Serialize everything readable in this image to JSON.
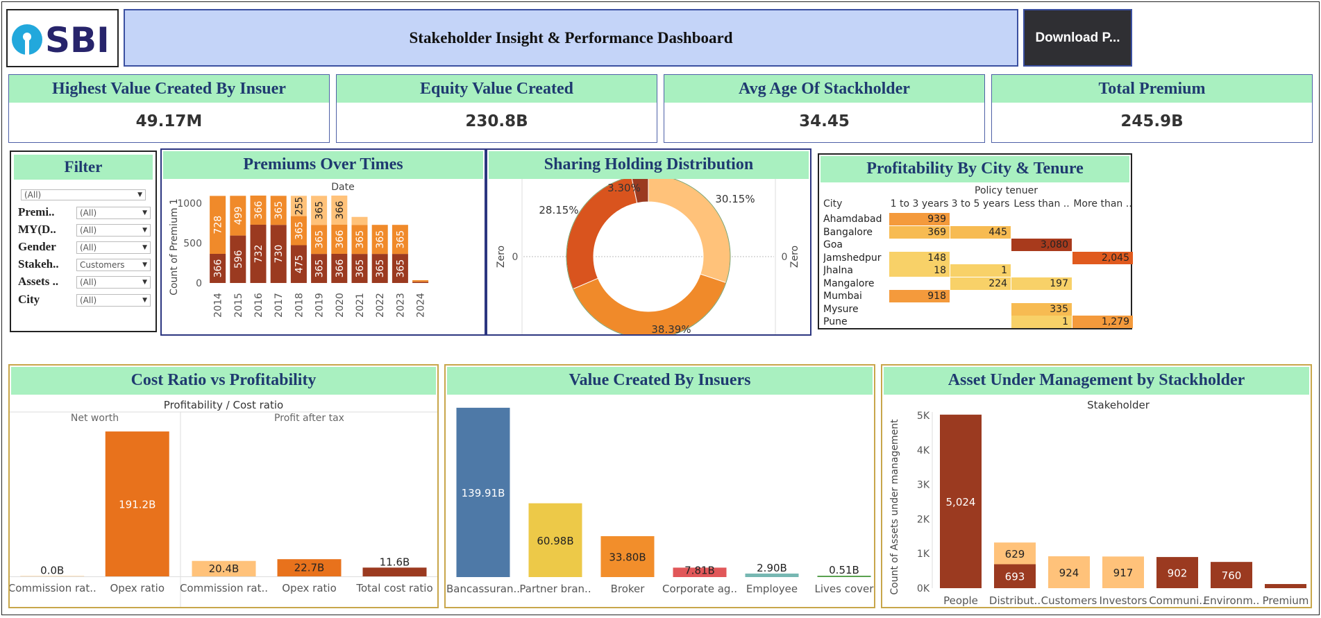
{
  "header": {
    "logo_text": "SBI",
    "title": "Stakeholder Insight & Performance Dashboard",
    "download_label": "Download P..."
  },
  "kpis": [
    {
      "title": "Highest Value Created By Insuer",
      "value": "49.17M"
    },
    {
      "title": "Equity Value Created",
      "value": "230.8B"
    },
    {
      "title": "Avg Age Of Stackholder",
      "value": "34.45"
    },
    {
      "title": "Total Premium",
      "value": "245.9B"
    }
  ],
  "filter": {
    "title": "Filter",
    "top_value": "(All)",
    "rows": [
      {
        "label": "Premi..",
        "value": "(All)"
      },
      {
        "label": "MY(D..",
        "value": "(All)"
      },
      {
        "label": "Gender",
        "value": "(All)"
      },
      {
        "label": "Stakeh..",
        "value": "Customers"
      },
      {
        "label": "Assets ..",
        "value": "(All)"
      },
      {
        "label": "City",
        "value": "(All)"
      }
    ]
  },
  "colors": {
    "dark": "#9b3a20",
    "orange": "#f08a2a",
    "mid_orange": "#e8721c",
    "light": "#ffc27a",
    "pale": "#f6cd6a",
    "blue": "#4e79a7",
    "yellow": "#edc948",
    "red": "#e15759",
    "teal": "#76b7b2",
    "green_header": "#a9f0c0"
  },
  "premiums": {
    "title": "Premiums Over  Times",
    "chart_data": {
      "type": "bar",
      "title": "Premiums Over  Times",
      "xlabel": "Date",
      "ylabel": "Count of Premium 1",
      "ylim": [
        0,
        1150
      ],
      "yticks": [
        "0",
        "500",
        "1000"
      ],
      "categories": [
        "2014",
        "2015",
        "2016",
        "2017",
        "2018",
        "2019",
        "2020",
        "2021",
        "2022",
        "2023",
        "2024"
      ],
      "series": [
        {
          "values": [
            366,
            596,
            732,
            730,
            475,
            365,
            366,
            365,
            365,
            365,
            15
          ],
          "labels": [
            "366",
            "596",
            "732",
            "730",
            "475",
            "365",
            "366",
            "365",
            "365",
            "365",
            ""
          ],
          "color": "#9b3a20"
        },
        {
          "values": [
            728,
            499,
            366,
            365,
            365,
            365,
            366,
            365,
            365,
            365,
            20
          ],
          "labels": [
            "728",
            "499",
            "366",
            "365",
            "365",
            "365",
            "366",
            "365",
            "365",
            "365",
            ""
          ],
          "color": "#f08a2a"
        },
        {
          "values": [
            0,
            0,
            0,
            0,
            255,
            365,
            366,
            100,
            0,
            0,
            0
          ],
          "labels": [
            "",
            "",
            "",
            "",
            "255",
            "365",
            "366",
            "",
            "",
            "",
            ""
          ],
          "color": "#ffc27a"
        }
      ]
    }
  },
  "sharing": {
    "title": "Sharing Holding Distribution",
    "axis_label": "Zero",
    "zero_tick": "0",
    "chart_data": {
      "type": "pie",
      "title": "Sharing Holding Distribution",
      "values": [
        30.15,
        38.39,
        28.15,
        3.3
      ],
      "labels": [
        "30.15%",
        "38.39%",
        "28.15%",
        "3.30%"
      ],
      "colors": [
        "#ffc27a",
        "#f08a2a",
        "#d9541e",
        "#9b3a20"
      ]
    }
  },
  "profitability": {
    "title": "Profitability By City & Tenure",
    "column_group": "Policy tenuer",
    "row_header": "City",
    "columns": [
      "1 to 3 years",
      "3 to 5 years",
      "Less than ..",
      "More than .."
    ],
    "rows": [
      {
        "city": "Ahamdabad",
        "cells": [
          "939",
          "",
          "",
          ""
        ]
      },
      {
        "city": "Bangalore",
        "cells": [
          "369",
          "445",
          "",
          ""
        ]
      },
      {
        "city": "Goa",
        "cells": [
          "",
          "",
          "3,080",
          ""
        ]
      },
      {
        "city": "Jamshedpur",
        "cells": [
          "148",
          "",
          "",
          "2,045"
        ]
      },
      {
        "city": "Jhalna",
        "cells": [
          "18",
          "1",
          "",
          ""
        ]
      },
      {
        "city": "Mangalore",
        "cells": [
          "",
          "224",
          "197",
          ""
        ]
      },
      {
        "city": "Mumbai",
        "cells": [
          "918",
          "",
          "",
          ""
        ]
      },
      {
        "city": "Mysure",
        "cells": [
          "",
          "",
          "335",
          ""
        ]
      },
      {
        "city": "Pune",
        "cells": [
          "",
          "",
          "1",
          "1,279"
        ]
      }
    ],
    "chart_data": {
      "type": "heatmap",
      "title": "Profitability By City & Tenure",
      "xlabel": "Policy tenuer",
      "ylabel": "City",
      "x": [
        "1 to 3 years",
        "3 to 5 years",
        "Less than ..",
        "More than .."
      ],
      "y": [
        "Ahamdabad",
        "Bangalore",
        "Goa",
        "Jamshedpur",
        "Jhalna",
        "Mangalore",
        "Mumbai",
        "Mysure",
        "Pune"
      ],
      "values": [
        [
          939,
          null,
          null,
          null
        ],
        [
          369,
          445,
          null,
          null
        ],
        [
          null,
          null,
          3080,
          null
        ],
        [
          148,
          null,
          null,
          2045
        ],
        [
          18,
          1,
          null,
          null
        ],
        [
          null,
          224,
          197,
          null
        ],
        [
          918,
          null,
          null,
          null
        ],
        [
          null,
          null,
          335,
          null
        ],
        [
          null,
          null,
          1,
          1279
        ]
      ]
    }
  },
  "costratio": {
    "title": "Cost Ratio vs Profitability",
    "chart_data": {
      "type": "bar",
      "title": "Profitability / Cost ratio",
      "groups": [
        {
          "name": "Net worth",
          "categories": [
            "Commission rat..",
            "Opex ratio"
          ],
          "values": [
            0.0,
            191.2
          ],
          "labels": [
            "0.0B",
            "191.2B"
          ],
          "colors": [
            "#ffc27a",
            "#e8721c"
          ]
        },
        {
          "name": "Profit after tax",
          "categories": [
            "Commission rat..",
            "Opex ratio",
            "Total cost ratio"
          ],
          "values": [
            20.4,
            22.7,
            11.6
          ],
          "labels": [
            "20.4B",
            "22.7B",
            "11.6B"
          ],
          "colors": [
            "#ffc27a",
            "#e8721c",
            "#9b3a20"
          ]
        }
      ],
      "ylim": [
        0,
        205
      ]
    }
  },
  "valuecreated": {
    "title": "Value Created By Insuers",
    "chart_data": {
      "type": "bar",
      "title": "Value Created By Insuers",
      "categories": [
        "Bancassuran..",
        "Partner bran..",
        "Broker",
        "Corporate ag..",
        "Employee",
        "Lives cover"
      ],
      "values": [
        139.91,
        60.98,
        33.8,
        7.81,
        2.9,
        0.51
      ],
      "labels": [
        "139.91B",
        "60.98B",
        "33.80B",
        "7.81B",
        "2.90B",
        "0.51B"
      ],
      "colors": [
        "#4e79a7",
        "#edc948",
        "#f28e2b",
        "#e15759",
        "#76b7b2",
        "#59a14f"
      ],
      "ylim": [
        0,
        145
      ]
    }
  },
  "aum": {
    "title": "Asset Under Management by Stackholder",
    "chart_data": {
      "type": "bar",
      "title": "Stakeholder",
      "ylabel": "Count of Assets under management",
      "ylim": [
        0,
        5300
      ],
      "yticks": [
        "0K",
        "1K",
        "2K",
        "3K",
        "4K",
        "5K"
      ],
      "categories": [
        "People",
        "Distribut..",
        "Customers",
        "Investors",
        "Communi..",
        "Environm..",
        "Premium"
      ],
      "series": [
        {
          "values": [
            5024,
            693,
            924,
            917,
            902,
            760,
            120
          ],
          "labels": [
            "5,024",
            "693",
            "924",
            "917",
            "902",
            "760",
            ""
          ],
          "colors": [
            "#9b3a20",
            "#9b3a20",
            "#ffc27a",
            "#ffc27a",
            "#9b3a20",
            "#9b3a20",
            "#9b3a20"
          ]
        },
        {
          "values": [
            0,
            629,
            0,
            0,
            0,
            0,
            0
          ],
          "labels": [
            "",
            "629",
            "",
            "",
            "",
            "",
            ""
          ],
          "colors": [
            "#ffc27a",
            "#ffc27a",
            "#ffc27a",
            "#ffc27a",
            "#ffc27a",
            "#ffc27a",
            "#ffc27a"
          ]
        }
      ]
    }
  }
}
